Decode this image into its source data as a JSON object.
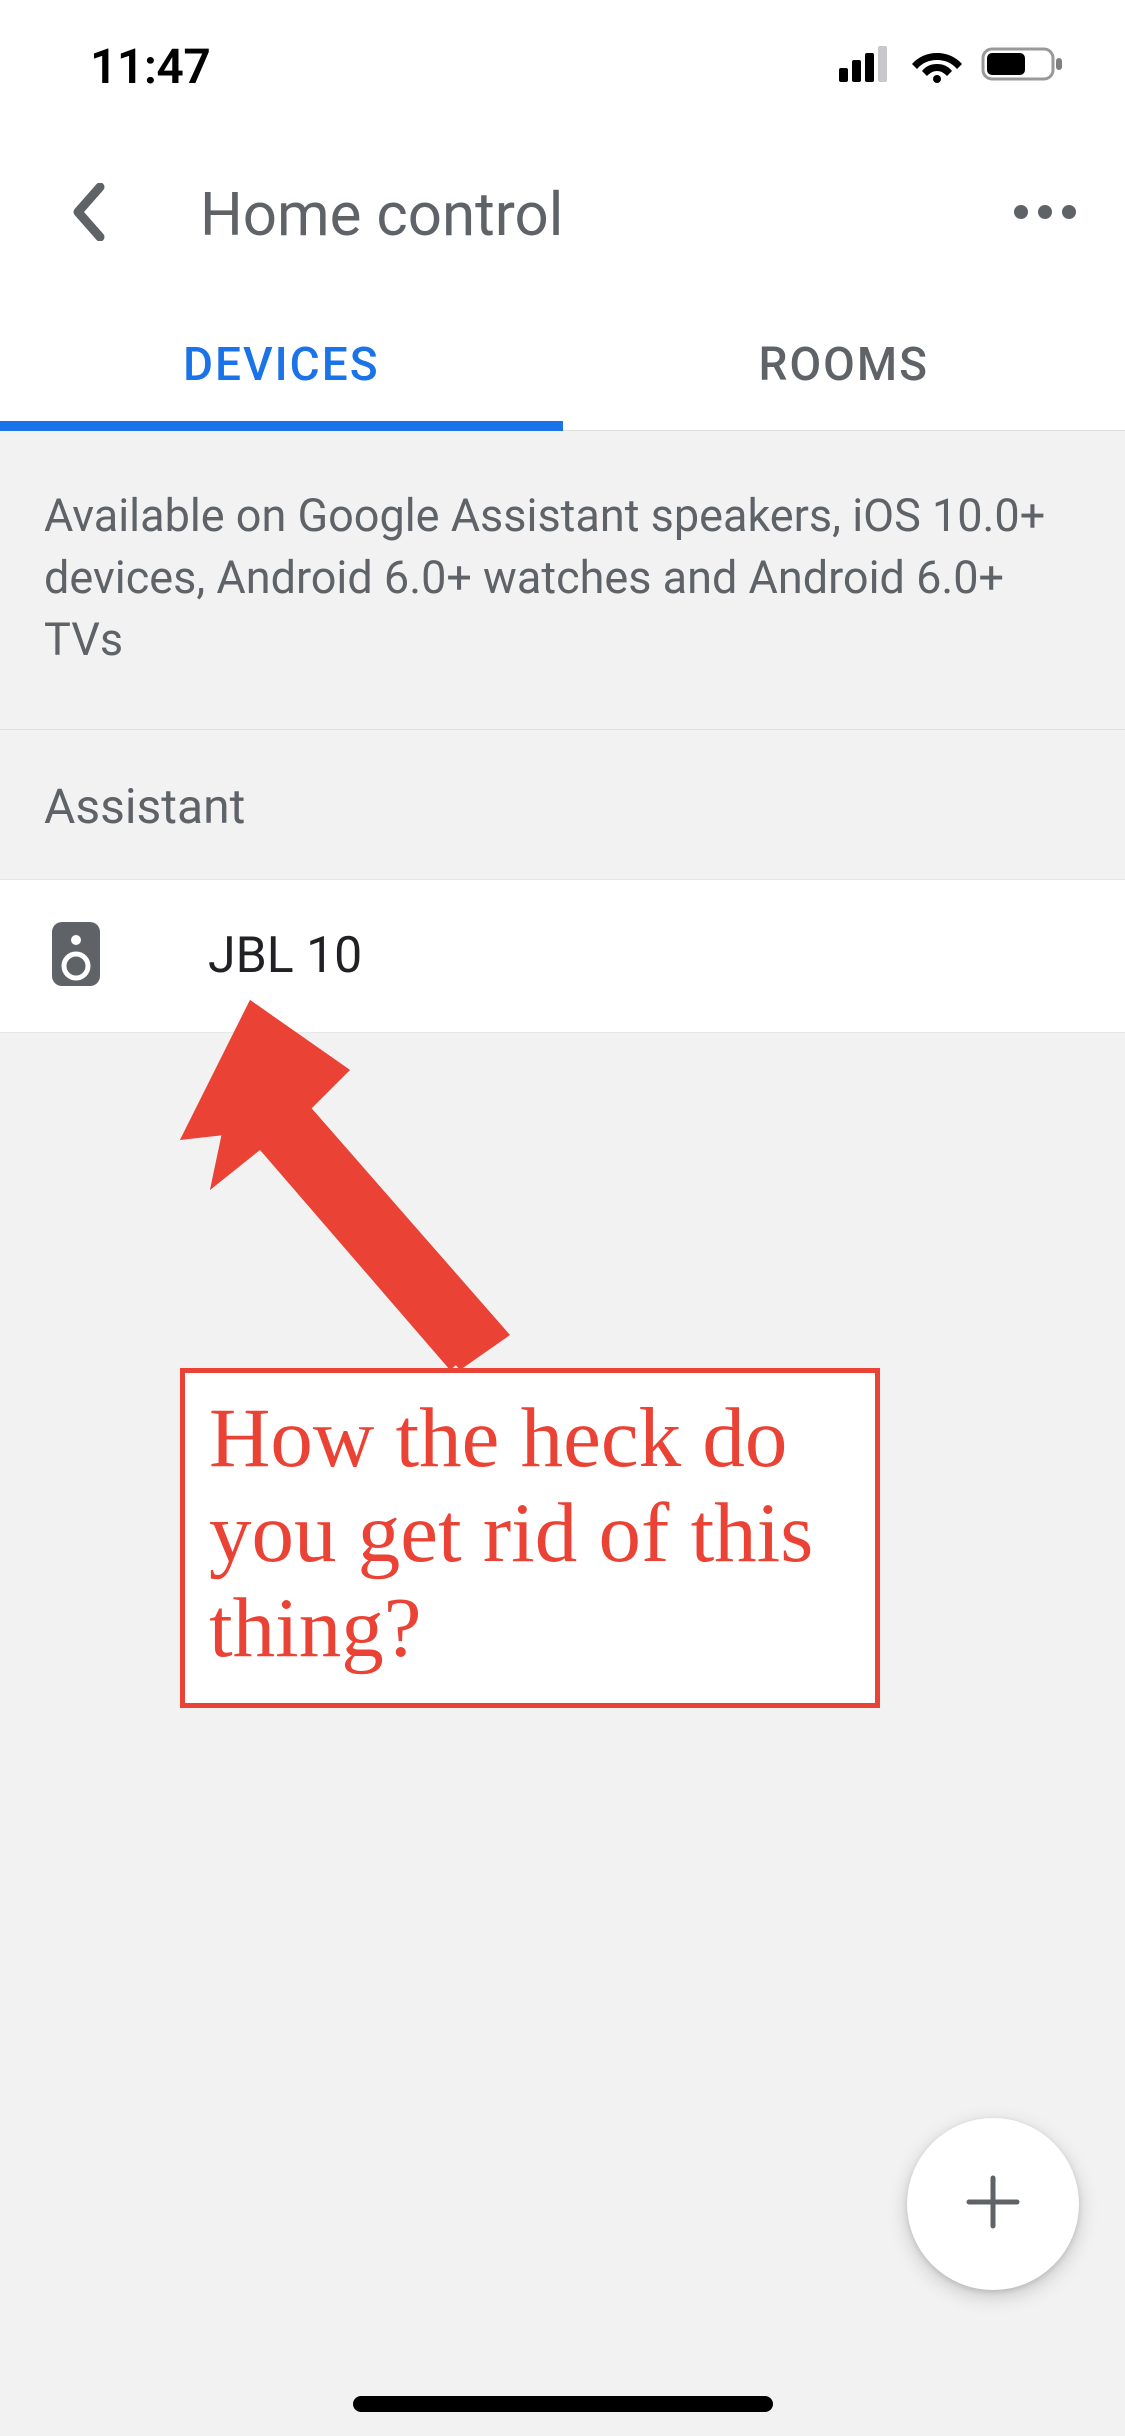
{
  "status": {
    "time": "11:47"
  },
  "header": {
    "title": "Home control"
  },
  "tabs": {
    "devices": "DEVICES",
    "rooms": "ROOMS",
    "active": "devices"
  },
  "info": {
    "prefix": "Available on ",
    "b1": "Google Assistant speakers",
    "sep1": ", ",
    "b2": "iOS 10.0+ devices",
    "sep2": ", ",
    "b3": "Android 6.0+ watches",
    "mid": " and ",
    "b4": "Android 6.0+ TVs"
  },
  "section": {
    "assistant": "Assistant"
  },
  "devices": [
    {
      "name": "JBL 10"
    }
  ],
  "annotation": {
    "text": "How the heck do you get rid of this thing?"
  }
}
